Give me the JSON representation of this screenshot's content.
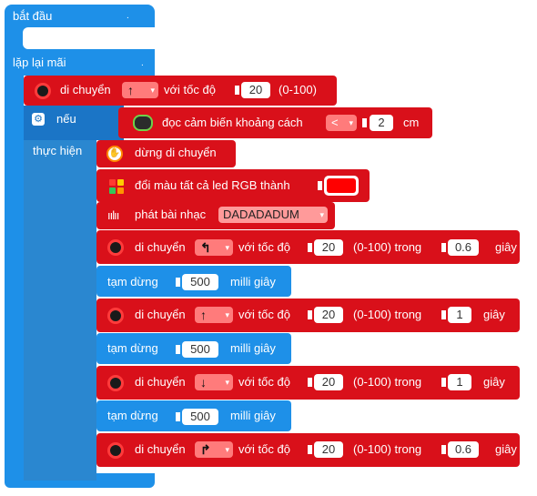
{
  "start_block": {
    "label": "bắt đầu"
  },
  "loop_block": {
    "label": "lặp lại mãi"
  },
  "move1": {
    "label": "di chuyển",
    "direction": "↑",
    "speed_label": "với tốc độ",
    "speed": "20",
    "range": "(0-100)"
  },
  "if_block": {
    "if_label": "nếu",
    "then_label": "thực hiện"
  },
  "sensor": {
    "label": "đọc cảm biến khoảng cách",
    "op": "<",
    "value": "2",
    "unit": "cm"
  },
  "stop": {
    "label": "dừng di chuyển"
  },
  "rgb": {
    "label": "đổi màu tất cả led RGB thành",
    "color": "#ff0000"
  },
  "music": {
    "label": "phát bài nhạc",
    "song": "DADADADUM"
  },
  "moves": [
    {
      "label": "di chuyển",
      "direction": "↰",
      "speed_label": "với tốc độ",
      "speed": "20",
      "range": "(0-100) trong",
      "duration": "0.6",
      "unit": "giây"
    },
    {
      "label": "di chuyển",
      "direction": "↑",
      "speed_label": "với tốc độ",
      "speed": "20",
      "range": "(0-100) trong",
      "duration": "1",
      "unit": "giây"
    },
    {
      "label": "di chuyển",
      "direction": "↓",
      "speed_label": "với tốc độ",
      "speed": "20",
      "range": "(0-100) trong",
      "duration": "1",
      "unit": "giây"
    },
    {
      "label": "di chuyển",
      "direction": "↱",
      "speed_label": "với tốc độ",
      "speed": "20",
      "range": "(0-100) trong",
      "duration": "0.6",
      "unit": "giây"
    }
  ],
  "pauses": [
    {
      "label": "tạm dừng",
      "value": "500",
      "unit": "milli giây"
    },
    {
      "label": "tạm dừng",
      "value": "500",
      "unit": "milli giây"
    },
    {
      "label": "tạm dừng",
      "value": "500",
      "unit": "milli giây"
    }
  ],
  "colors": {
    "blue": "#1e90e8",
    "red": "#d9101a",
    "dropdown": "#ff6b6b"
  },
  "icons": [
    "wheel-icon",
    "gear-icon",
    "robot-eyes-icon",
    "hand-stop-icon",
    "rgb-grid-icon",
    "music-wave-icon"
  ]
}
